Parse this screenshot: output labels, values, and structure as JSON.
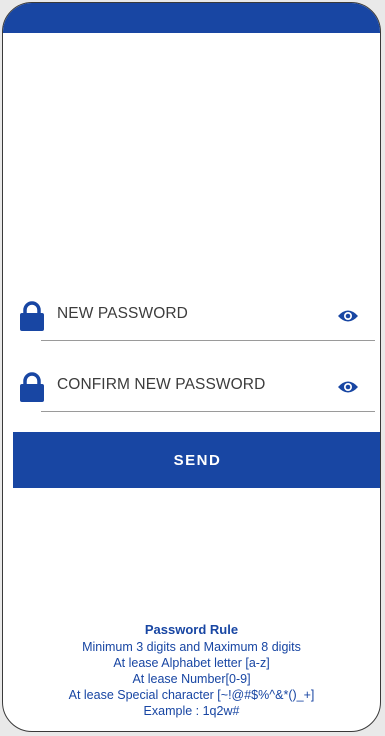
{
  "colors": {
    "primary": "#1846a3",
    "text": "#3c3c3c",
    "underline": "#9a9a9a"
  },
  "form": {
    "new_password_label": "NEW PASSWORD",
    "confirm_password_label": "CONFIRM NEW PASSWORD",
    "lock_icon": "lock-icon",
    "visibility_icon": "eye-icon",
    "send_label": "SEND"
  },
  "password_rule": {
    "title": "Password Rule",
    "lines": [
      "Minimum 3 digits and Maximum 8 digits",
      "At lease Alphabet letter [a-z]",
      "At lease Number[0-9]",
      "At lease Special character [~!@#$%^&*()_+]",
      "Example : 1q2w#"
    ]
  }
}
